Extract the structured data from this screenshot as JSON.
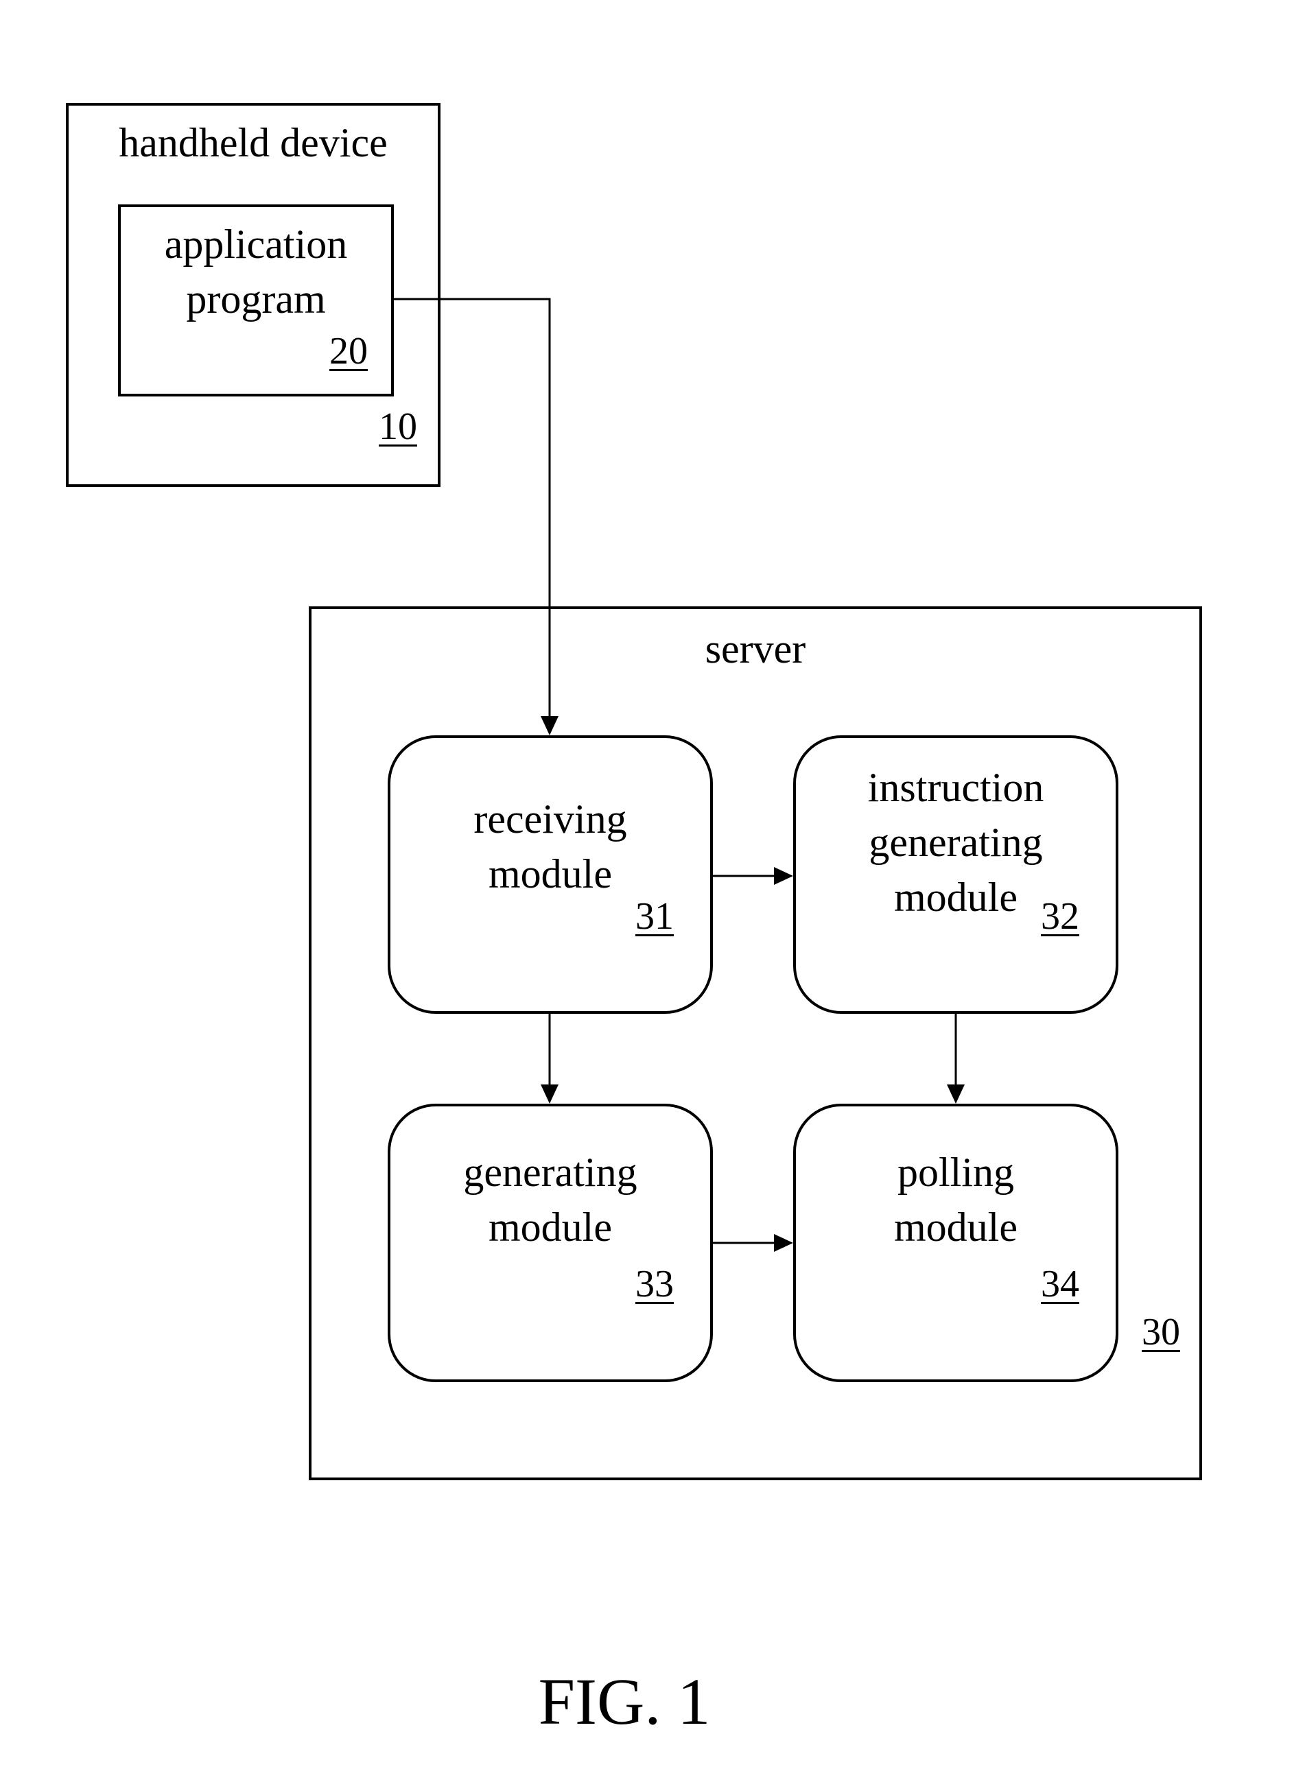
{
  "figure": {
    "caption": "FIG. 1"
  },
  "handheld_device": {
    "title": "handheld device",
    "ref": "10",
    "application_program": {
      "line1": "application",
      "line2": "program",
      "ref": "20"
    }
  },
  "server": {
    "title": "server",
    "ref": "30",
    "modules": [
      {
        "id": "receiving",
        "lines": [
          "receiving",
          "module"
        ],
        "ref": "31"
      },
      {
        "id": "instruction-generating",
        "lines": [
          "instruction",
          "generating",
          "module"
        ],
        "ref": "32"
      },
      {
        "id": "generating",
        "lines": [
          "generating",
          "module"
        ],
        "ref": "33"
      },
      {
        "id": "polling",
        "lines": [
          "polling",
          "module"
        ],
        "ref": "34"
      }
    ]
  },
  "connections": [
    {
      "from": "application-program-20",
      "to": "receiving-module-31"
    },
    {
      "from": "receiving-module-31",
      "to": "instruction-generating-module-32"
    },
    {
      "from": "receiving-module-31",
      "to": "generating-module-33"
    },
    {
      "from": "instruction-generating-module-32",
      "to": "polling-module-34"
    },
    {
      "from": "generating-module-33",
      "to": "polling-module-34"
    }
  ]
}
